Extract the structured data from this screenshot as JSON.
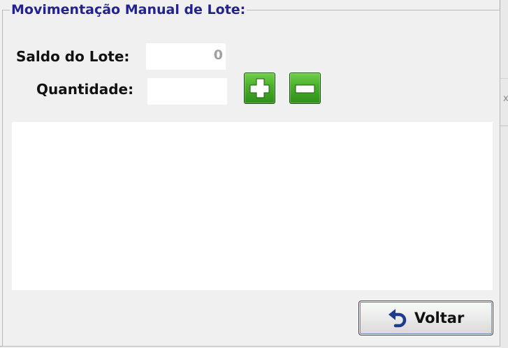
{
  "dialog": {
    "title": "Movimentação Manual de Lote:"
  },
  "form": {
    "saldo_label": "Saldo do Lote:",
    "saldo_value": "0",
    "quantidade_label": "Quantidade:",
    "quantidade_value": ""
  },
  "actions": {
    "add_icon": "plus-icon",
    "remove_icon": "minus-icon",
    "back_label": "Voltar",
    "back_icon": "undo-icon"
  },
  "background": {
    "partial_glyph": "x"
  },
  "colors": {
    "title": "#23238f",
    "button_green": "#4cb02b",
    "window_bg": "#f0f0f0"
  }
}
